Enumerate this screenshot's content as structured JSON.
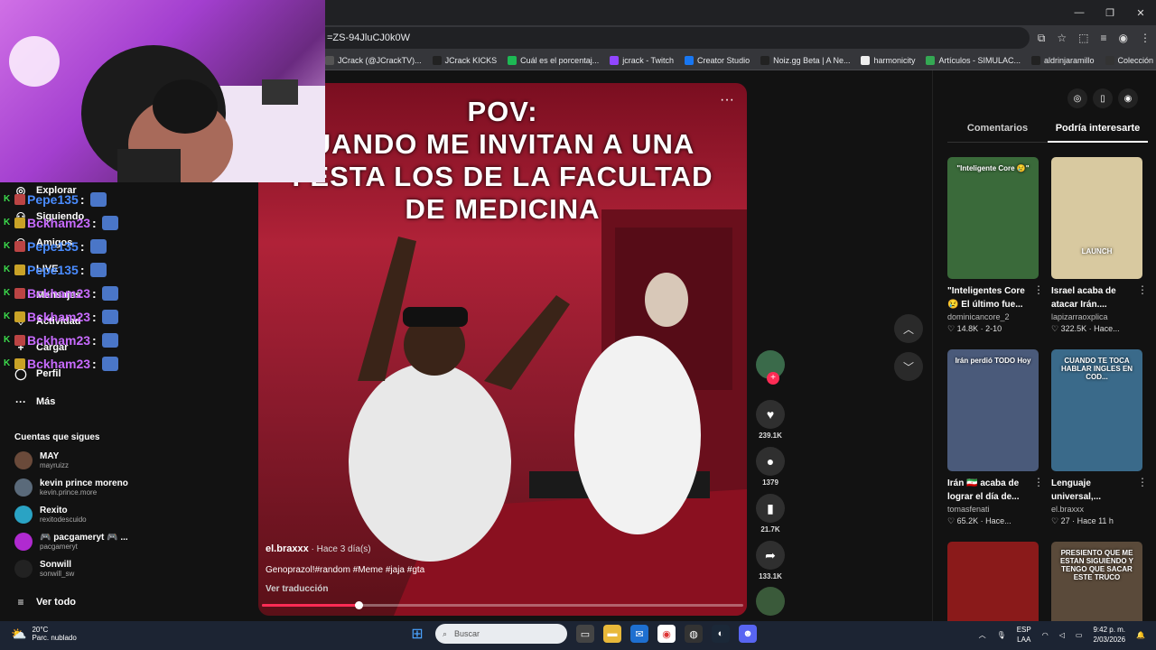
{
  "browser": {
    "url": "=ZS-94JluCJ0k0W",
    "bookmarks": [
      {
        "label": "JCrack (@JCrackTV)...",
        "color": "#555"
      },
      {
        "label": "JCrack KICKS",
        "color": "#222"
      },
      {
        "label": "Cuál es el porcentaj...",
        "color": "#1db954"
      },
      {
        "label": "jcrack - Twitch",
        "color": "#9146ff"
      },
      {
        "label": "Creator Studio",
        "color": "#1877f2"
      },
      {
        "label": "Noiz.gg Beta | A Ne...",
        "color": "#222"
      },
      {
        "label": "harmonicity",
        "color": "#eee"
      },
      {
        "label": "Artículos - SIMULAC...",
        "color": "#34a853"
      },
      {
        "label": "aldrinjaramillo",
        "color": "#222"
      },
      {
        "label": "Colección de M_blei...",
        "color": "#333"
      }
    ]
  },
  "sidebar": {
    "nav": [
      {
        "label": "Explorar",
        "icon": "compass-icon",
        "glyph": "◎"
      },
      {
        "label": "Siguiendo",
        "icon": "following-icon",
        "glyph": "⚇"
      },
      {
        "label": "Amigos",
        "icon": "friends-icon",
        "glyph": "⚇"
      },
      {
        "label": "LIVE",
        "icon": "live-icon",
        "glyph": "▣"
      },
      {
        "label": "Mensajes",
        "icon": "messages-icon",
        "glyph": "✉"
      },
      {
        "label": "Actividad",
        "icon": "activity-icon",
        "glyph": "♡"
      },
      {
        "label": "Cargar",
        "icon": "upload-icon",
        "glyph": "+"
      },
      {
        "label": "Perfil",
        "icon": "profile-icon",
        "glyph": "◯"
      },
      {
        "label": "Más",
        "icon": "more-icon",
        "glyph": "···"
      }
    ],
    "following_title": "Cuentas que sigues",
    "accounts": [
      {
        "name": "MAY",
        "handle": "mayruizz",
        "color": "#6a4a3a"
      },
      {
        "name": "kevin prince moreno",
        "handle": "kevin.prince.more",
        "color": "#5a6a7a"
      },
      {
        "name": "Rexito",
        "handle": "rexitodescuido",
        "color": "#2aa3c4"
      },
      {
        "name": "🎮 pacgameryt 🎮 ...",
        "handle": "pacgameryt",
        "color": "#b02ad0"
      },
      {
        "name": "Sonwill",
        "handle": "sonwill_sw",
        "color": "#222"
      }
    ],
    "see_all": "Ver todo"
  },
  "chat": [
    {
      "user": "Pepe135",
      "color": "#4a8cff"
    },
    {
      "user": "Bckham23",
      "color": "#c86bff"
    },
    {
      "user": "Pepe135",
      "color": "#4a8cff"
    },
    {
      "user": "Pepe135",
      "color": "#4a8cff"
    },
    {
      "user": "Bckham23",
      "color": "#c86bff"
    },
    {
      "user": "Bckham23",
      "color": "#c86bff"
    },
    {
      "user": "Bckham23",
      "color": "#c86bff"
    },
    {
      "user": "Bckham23",
      "color": "#c86bff"
    }
  ],
  "chat_separator": ":",
  "video": {
    "caption_lines": [
      "POV:",
      "UANDO ME INVITAN A UNA",
      "FESTA LOS DE LA FACULTAD",
      "DE MEDICINA"
    ],
    "author": "el.braxxx",
    "time": "· Hace 3 día(s)",
    "description": "Genoprazol!#random #Meme #jaja #gta",
    "translate": "Ver traducción",
    "progress": 0.2
  },
  "actions": {
    "likes": "239.1K",
    "comments": "1379",
    "saves": "21.7K",
    "shares": "133.1K"
  },
  "panel": {
    "tabs": [
      "Comentarios",
      "Podría interesarte"
    ],
    "active_tab": 1,
    "recs": [
      {
        "title": "\"Inteligentes Core 😢 El último fue...",
        "author": "dominicancore_2",
        "stats": "♡ 14.8K  ·  2-10",
        "bg": "#3a6a3a",
        "thumb_text": "\"Inteligente Core 😢\""
      },
      {
        "title": "Israel acaba de atacar Irán....",
        "author": "lapizarraoxplica",
        "stats": "♡ 322.5K  ·  Hace...",
        "bg": "#d8c9a0",
        "thumb_text": "LAUNCH"
      },
      {
        "title": "Irán 🇮🇷 acaba de lograr el día de...",
        "author": "tomasfenati",
        "stats": "♡ 65.2K  ·  Hace...",
        "bg": "#4a5a7a",
        "thumb_text": "Irán perdió TODO Hoy"
      },
      {
        "title": "Lenguaje universal,...",
        "author": "el.braxxx",
        "stats": "♡ 27  ·  Hace 11 h",
        "bg": "#3a6a8a",
        "thumb_text": "CUANDO TE TOCA HABLAR INGLES EN COD..."
      },
      {
        "title": "",
        "author": "",
        "stats": "",
        "bg": "#8a1a1a",
        "thumb_text": ""
      },
      {
        "title": "",
        "author": "",
        "stats": "",
        "bg": "#5a4a3a",
        "thumb_text": "PRESIENTO QUE ME ESTAN SIGUIENDO Y TENGO QUE SACAR ESTE TRUCO"
      }
    ]
  },
  "taskbar": {
    "temp": "20°C",
    "weather": "Parc. nublado",
    "search": "Buscar",
    "lang1": "ESP",
    "lang2": "LAA",
    "time": "9:42 p. m.",
    "date": "2/03/2026"
  }
}
